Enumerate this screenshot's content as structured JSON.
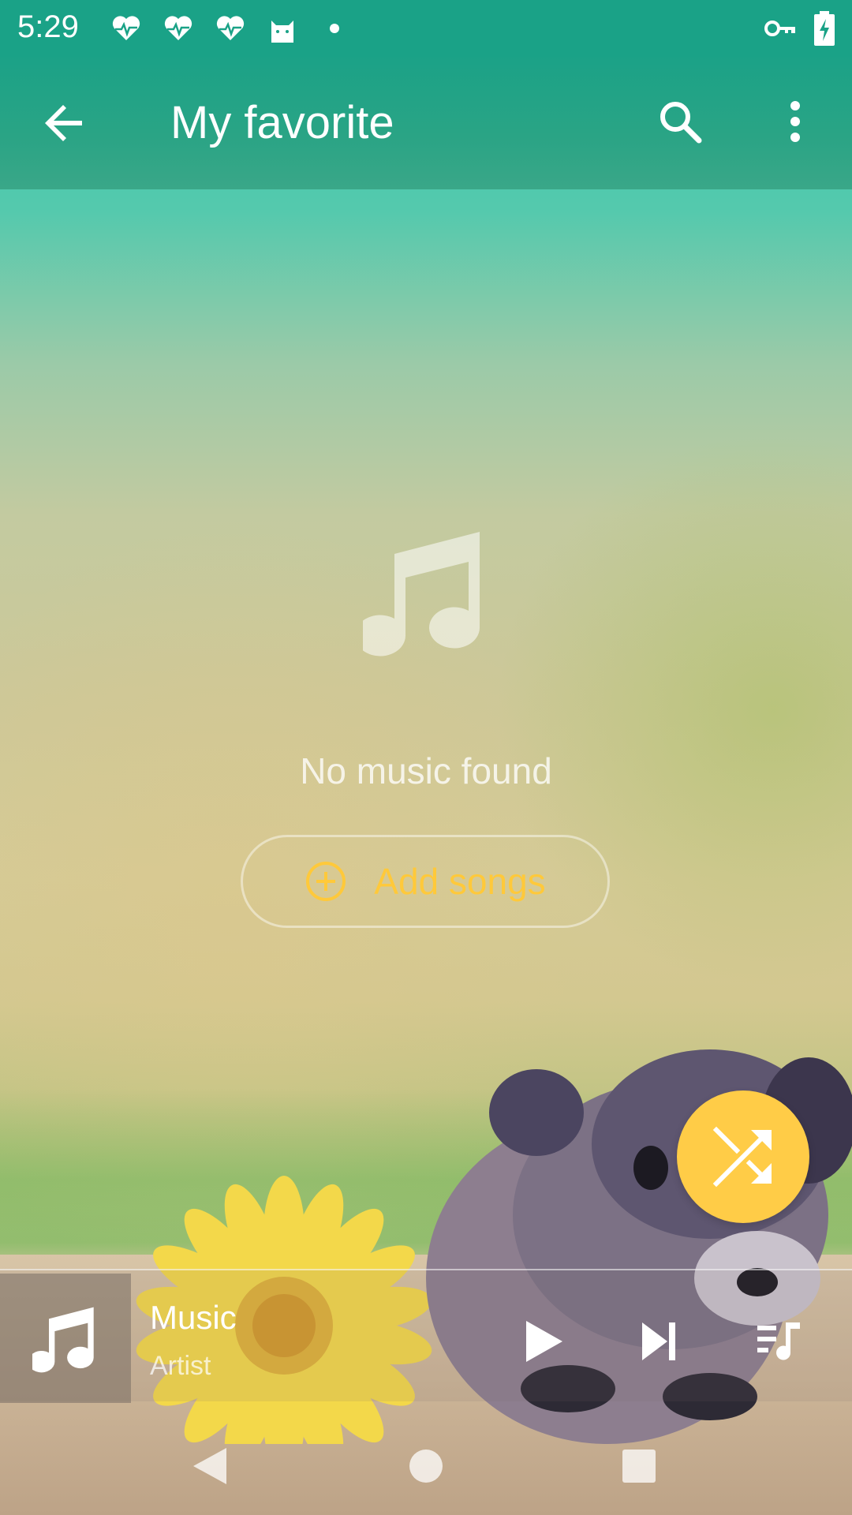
{
  "status_bar": {
    "time": "5:29",
    "left_icons": [
      "heart-pulse-icon",
      "heart-pulse-icon",
      "heart-pulse-icon",
      "cat-icon",
      "dot-icon"
    ],
    "right_icons": [
      "vpn-key-icon",
      "battery-charging-icon"
    ]
  },
  "app_bar": {
    "title": "My favorite",
    "back_icon": "arrow-back-icon",
    "search_icon": "search-icon",
    "more_icon": "more-vert-icon"
  },
  "empty_state": {
    "icon": "music-note-icon",
    "message": "No music found",
    "add_button_label": "Add songs",
    "add_button_icon": "add-circle-icon"
  },
  "fab": {
    "icon": "shuffle-icon",
    "color": "#ffcc47"
  },
  "mini_player": {
    "title": "Music",
    "artist": "Artist",
    "art_icon": "music-note-icon",
    "controls": [
      "play-icon",
      "skip-next-icon",
      "queue-music-icon"
    ]
  },
  "nav_bar": {
    "buttons": [
      "nav-back-icon",
      "nav-home-icon",
      "nav-recents-icon"
    ]
  },
  "colors": {
    "status_bar": "#1aa287",
    "accent": "#ffc93a"
  }
}
